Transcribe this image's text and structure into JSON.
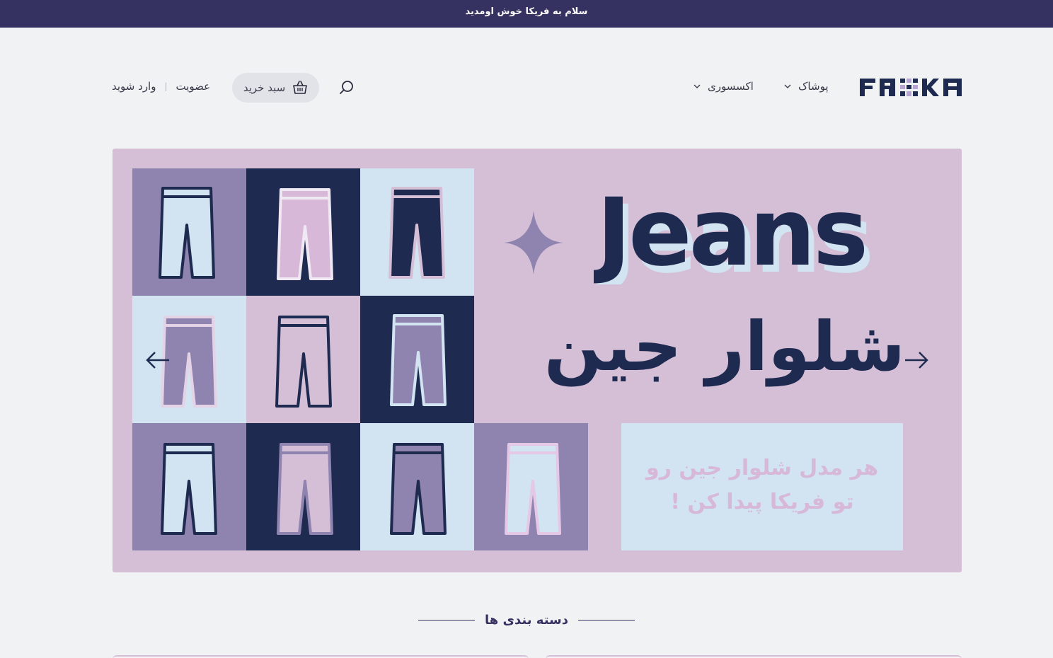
{
  "topbar": {
    "welcome_text": "سلام به فریکا خوش اومدید"
  },
  "header": {
    "logo_text": "FRIKA",
    "nav": [
      {
        "label": "پوشاک",
        "icon": "chevron-down-icon"
      },
      {
        "label": "اکسسوری",
        "icon": "chevron-down-icon"
      }
    ],
    "search_icon": "search-icon",
    "cart": {
      "label": "سبد خرید",
      "icon": "basket-icon"
    },
    "auth": {
      "signup": "عضویت",
      "separator": "|",
      "login": "وارد شوید"
    }
  },
  "banner": {
    "title_en": "Jeans",
    "title_fa": "شلوار جین",
    "subtitle_line1": "هر مدل شلوار جین رو",
    "subtitle_line2": "تو فریکا پیدا کن !",
    "prev_icon": "arrow-left-icon",
    "next_icon": "arrow-right-icon",
    "colors": {
      "background": "#d5bfd6",
      "navy": "#1e2a50",
      "lilac": "#8f84b0",
      "light_blue": "#d2e3f1",
      "pink": "#d7b8d8"
    }
  },
  "categories": {
    "title": "دسته بندی ها"
  },
  "theme": {
    "topbar_bg": "#353160",
    "page_bg": "#f1f2f4"
  }
}
